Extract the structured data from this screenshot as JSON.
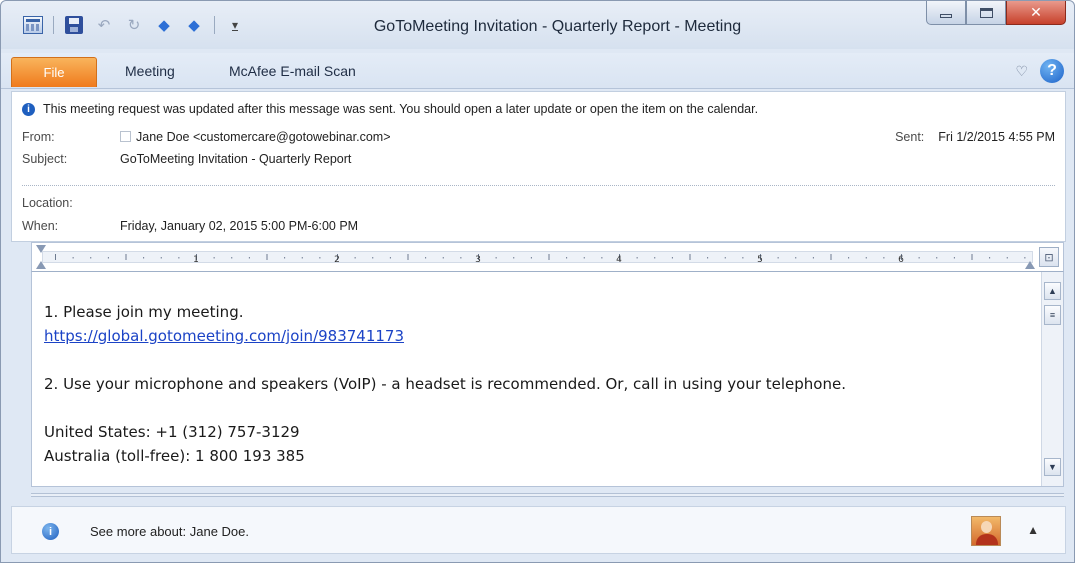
{
  "window": {
    "title": "GoToMeeting Invitation - Quarterly Report  -  Meeting"
  },
  "ribbon": {
    "tabs": [
      {
        "label": "File"
      },
      {
        "label": "Meeting"
      },
      {
        "label": "McAfee E-mail Scan"
      }
    ],
    "help_label": "?"
  },
  "header": {
    "info_message": "This meeting request was updated after this message was sent. You should open a later update or open the item on the calendar.",
    "from_label": "From:",
    "from_value": "Jane Doe <customercare@gotowebinar.com>",
    "sent_label": "Sent:",
    "sent_value": "Fri 1/2/2015 4:55 PM",
    "subject_label": "Subject:",
    "subject_value": "GoToMeeting Invitation - Quarterly Report",
    "location_label": "Location:",
    "location_value": "",
    "when_label": "When:",
    "when_value": "Friday, January 02, 2015 5:00 PM-6:00 PM"
  },
  "ruler": {
    "numbers": [
      "1",
      "2",
      "3",
      "4",
      "5",
      "6"
    ]
  },
  "body": {
    "line1": "1.  Please join my meeting.",
    "link": "https://global.gotomeeting.com/join/983741173",
    "line2": "2.  Use your microphone and speakers (VoIP) - a headset is recommended.  Or, call in using your telephone.",
    "line3": "United States: +1 (312) 757-3129",
    "line4": "Australia (toll-free): 1 800 193 385"
  },
  "people_pane": {
    "text": "See more about: Jane Doe."
  },
  "icons": {
    "accent": "#ef7a1c",
    "info_blue": "#1f5fbf",
    "link_blue": "#1b43c6"
  }
}
